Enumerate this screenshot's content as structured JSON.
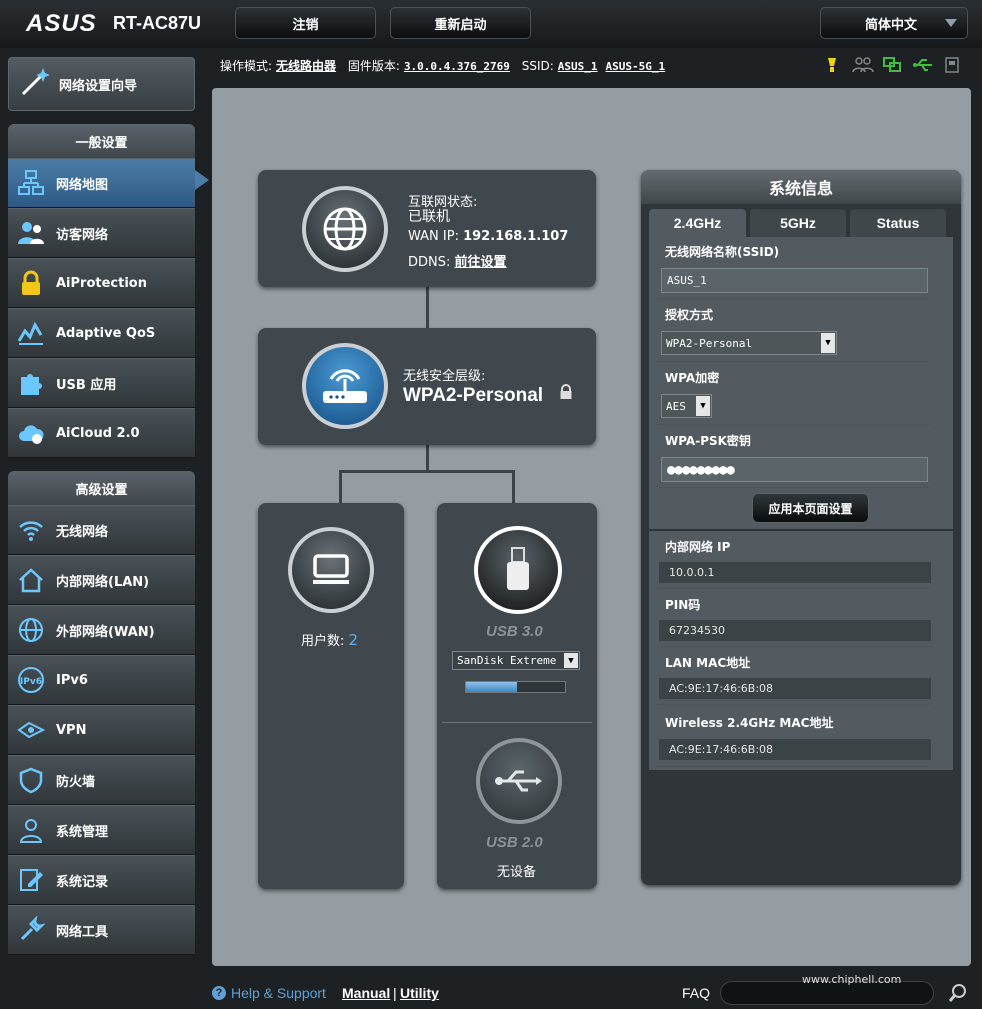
{
  "header": {
    "brand": "ASUS",
    "model": "RT-AC87U",
    "logout": "注销",
    "reboot": "重新启动",
    "language": "简体中文"
  },
  "infobar": {
    "mode_label": "操作模式:",
    "mode_value": "无线路由器",
    "fw_label": "固件版本:",
    "fw_value": "3.0.0.4.376_2769",
    "ssid_label": "SSID:",
    "ssid1": "ASUS_1",
    "ssid2": "ASUS-5G_1"
  },
  "sidebar": {
    "wizard": "网络设置向导",
    "general_header": "一般设置",
    "general": [
      {
        "label": "网络地图",
        "icon": "network-map-icon"
      },
      {
        "label": "访客网络",
        "icon": "guest-network-icon"
      },
      {
        "label": "AiProtection",
        "icon": "lock-icon"
      },
      {
        "label": "Adaptive QoS",
        "icon": "qos-icon"
      },
      {
        "label": "USB 应用",
        "icon": "puzzle-icon"
      },
      {
        "label": "AiCloud 2.0",
        "icon": "cloud-icon"
      }
    ],
    "advanced_header": "高级设置",
    "advanced": [
      {
        "label": "无线网络",
        "icon": "wifi-icon"
      },
      {
        "label": "内部网络(LAN)",
        "icon": "home-icon"
      },
      {
        "label": "外部网络(WAN)",
        "icon": "globe-icon"
      },
      {
        "label": "IPv6",
        "icon": "ipv6-icon"
      },
      {
        "label": "VPN",
        "icon": "vpn-icon"
      },
      {
        "label": "防火墙",
        "icon": "shield-icon"
      },
      {
        "label": "系统管理",
        "icon": "admin-icon"
      },
      {
        "label": "系统记录",
        "icon": "log-icon"
      },
      {
        "label": "网络工具",
        "icon": "tools-icon"
      }
    ]
  },
  "map": {
    "internet_status_label": "互联网状态:",
    "internet_status": "已联机",
    "wan_ip_label": "WAN IP:",
    "wan_ip": "192.168.1.107",
    "ddns_label": "DDNS:",
    "ddns_link": "前往设置",
    "security_label": "无线安全层级:",
    "security_value": "WPA2-Personal",
    "clients_label": "用户数:",
    "clients_count": "2",
    "usb3_label": "USB 3.0",
    "usb3_device": "SanDisk Extreme",
    "usb3_usage_fraction": 0.52,
    "usb2_label": "USB 2.0",
    "usb2_status": "无设备"
  },
  "sysinfo": {
    "title": "系统信息",
    "tabs": [
      "2.4GHz",
      "5GHz",
      "Status"
    ],
    "ssid_label": "无线网络名称(SSID)",
    "ssid_value": "ASUS_1",
    "auth_label": "授权方式",
    "auth_value": "WPA2-Personal",
    "enc_label": "WPA加密",
    "enc_value": "AES",
    "psk_label": "WPA-PSK密钥",
    "psk_value": "●●●●●●●●●",
    "apply": "应用本页面设置",
    "lan_ip_label": "内部网络 IP",
    "lan_ip": "10.0.0.1",
    "pin_label": "PIN码",
    "pin": "67234530",
    "lan_mac_label": "LAN MAC地址",
    "lan_mac": "AC:9E:17:46:6B:08",
    "wl_mac_label": "Wireless 2.4GHz MAC地址",
    "wl_mac": "AC:9E:17:46:6B:08"
  },
  "footer": {
    "help": "Help & Support",
    "manual": "Manual",
    "sep": "|",
    "utility": "Utility",
    "faq": "FAQ",
    "watermark": "www.chiphell.com"
  }
}
